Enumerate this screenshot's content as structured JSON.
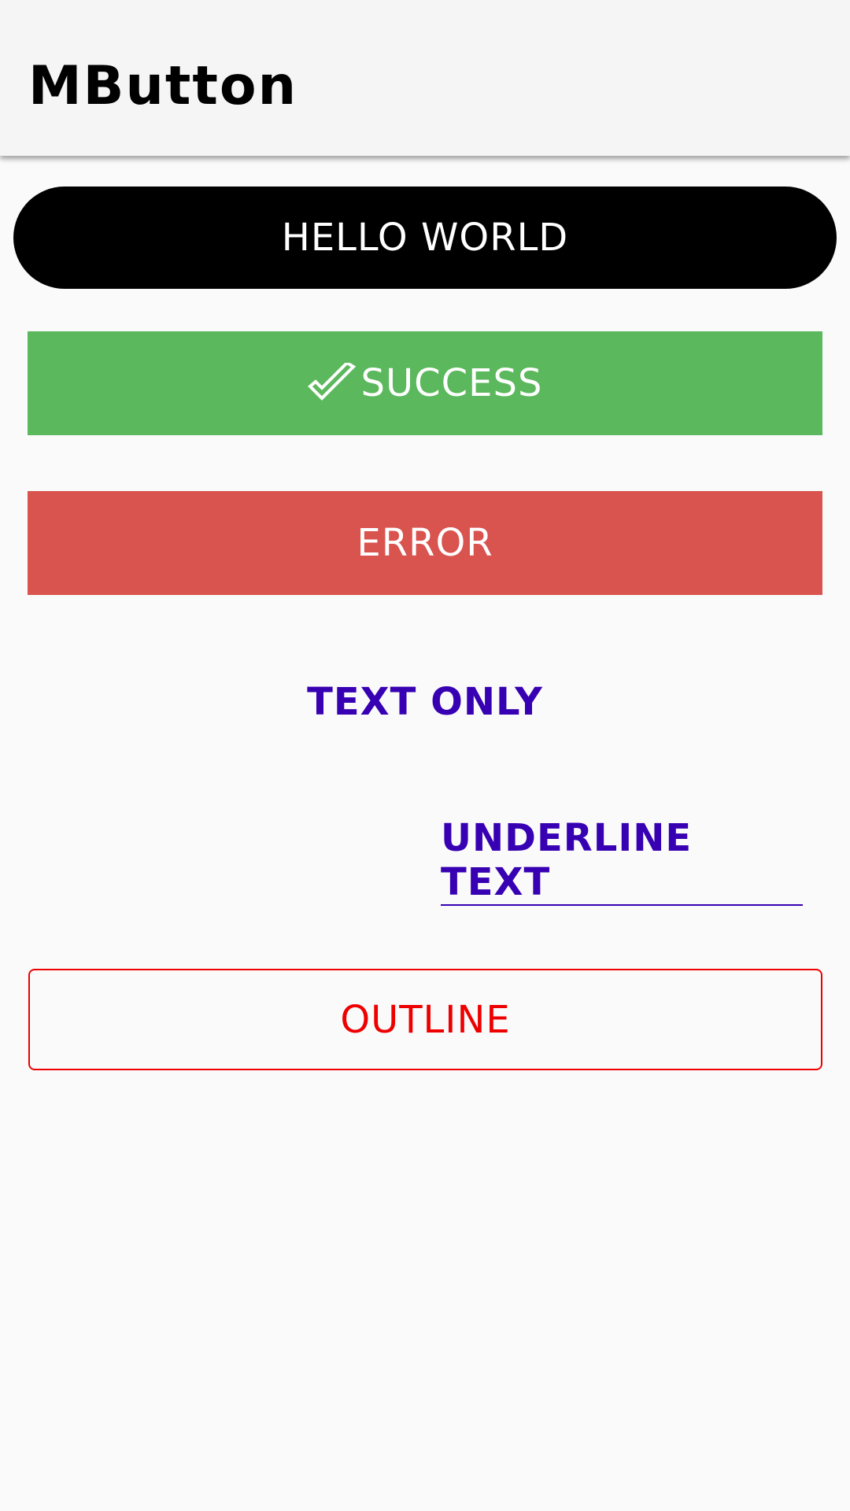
{
  "app_bar": {
    "title": "MButton"
  },
  "buttons": {
    "hello_world": "HELLO WORLD",
    "success": "SUCCESS",
    "error": "ERROR",
    "text_only": "TEXT ONLY",
    "underline_text": "UNDERLINE TEXT",
    "outline": "OUTLINE"
  },
  "colors": {
    "app_bar_bg": "#f5f5f5",
    "page_bg": "#fafafa",
    "hello_bg": "#000000",
    "success_bg": "#5cb85c",
    "error_bg": "#d9534f",
    "text_button": "#3700b3",
    "outline": "#ee0000"
  },
  "icons": {
    "success_icon": "check-icon"
  }
}
